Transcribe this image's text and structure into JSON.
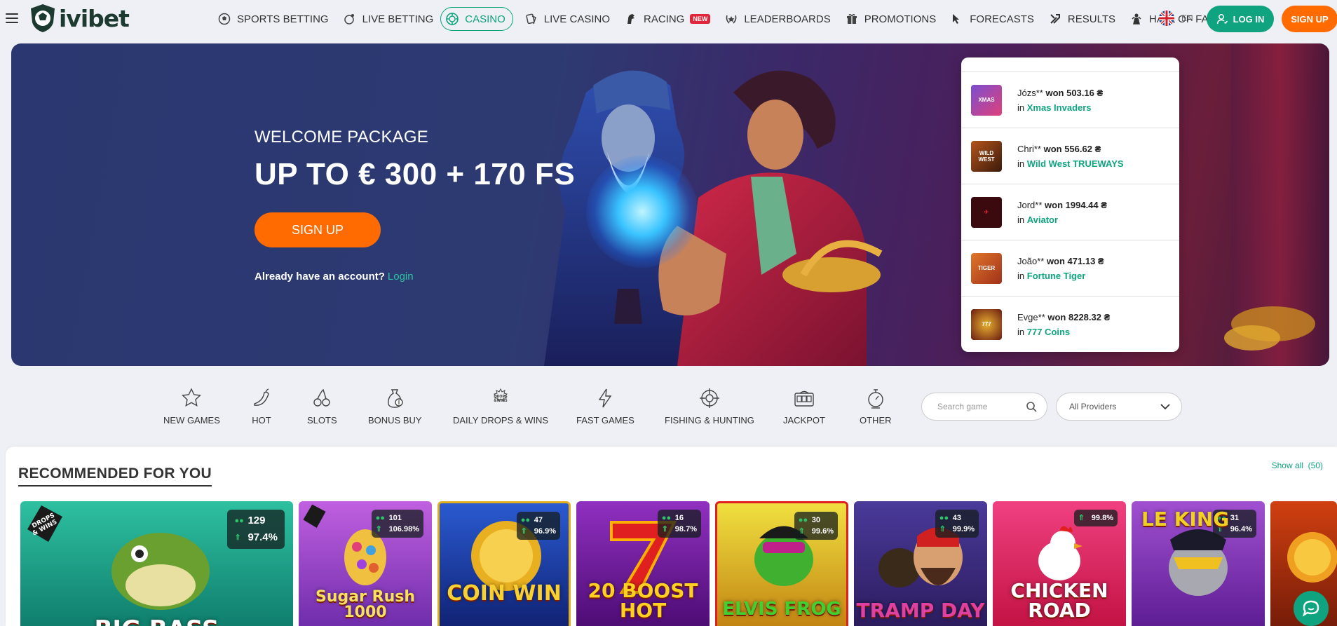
{
  "brand": {
    "name": "ivibet"
  },
  "nav": [
    {
      "label": "SPORTS BETTING",
      "icon": "soccer-ball-icon"
    },
    {
      "label": "LIVE BETTING",
      "icon": "live-ball-icon"
    },
    {
      "label": "CASINO",
      "icon": "casino-chip-icon",
      "active": true
    },
    {
      "label": "LIVE CASINO",
      "icon": "cards-icon"
    },
    {
      "label": "RACING",
      "icon": "horse-icon",
      "badge": "NEW"
    },
    {
      "label": "LEADERBOARDS",
      "icon": "laurel-icon"
    },
    {
      "label": "PROMOTIONS",
      "icon": "gift-icon"
    },
    {
      "label": "FORECASTS",
      "icon": "cursor-icon"
    },
    {
      "label": "RESULTS",
      "icon": "tools-icon"
    },
    {
      "label": "HALL OF FAME",
      "icon": "trophy-icon"
    }
  ],
  "header": {
    "lang": "EN",
    "login": "LOG IN",
    "signup": "SIGN UP"
  },
  "hero": {
    "welcome": "WELCOME PACKAGE",
    "headline": "UP TO € 300 + 170 FS",
    "cta": "SIGN UP",
    "account_text": "Already have an account?",
    "login_link": "Login"
  },
  "winners": [
    {
      "user": "Józs**",
      "won": "won 503.16 ₴",
      "in": "in",
      "game": "Xmas Invaders",
      "color": "#7a4fd0"
    },
    {
      "user": "Chri**",
      "won": "won 556.62 ₴",
      "in": "in",
      "game": "Wild West TRUEWAYS",
      "color": "#b4541c"
    },
    {
      "user": "Jord**",
      "won": "won 1994.44 ₴",
      "in": "in",
      "game": "Aviator",
      "color": "#7a0f14"
    },
    {
      "user": "João**",
      "won": "won 471.13 ₴",
      "in": "in",
      "game": "Fortune Tiger",
      "color": "#e0762a"
    },
    {
      "user": "Evge**",
      "won": "won 8228.32 ₴",
      "in": "in",
      "game": "777 Coins",
      "color": "#6a1a10"
    }
  ],
  "categories": [
    {
      "label": "NEW GAMES",
      "icon": "star-icon"
    },
    {
      "label": "HOT",
      "icon": "chili-icon"
    },
    {
      "label": "SLOTS",
      "icon": "cherries-icon"
    },
    {
      "label": "BONUS BUY",
      "icon": "money-bag-icon"
    },
    {
      "label": "DAILY DROPS & WINS",
      "icon": "drops-wins-icon"
    },
    {
      "label": "FAST GAMES",
      "icon": "lightning-icon"
    },
    {
      "label": "FISHING & HUNTING",
      "icon": "crosshair-icon"
    },
    {
      "label": "JACKPOT",
      "icon": "slot-machine-icon"
    },
    {
      "label": "OTHER",
      "icon": "stopwatch-icon"
    }
  ],
  "search": {
    "placeholder": "Search game",
    "providers": "All Providers"
  },
  "recommended": {
    "title": "RECOMMENDED FOR YOU",
    "show_all": "Show all",
    "count": "(50)",
    "games": [
      {
        "name": "BIG BASS",
        "players": "129",
        "rtp": "97.4%",
        "bg": "#19a88a"
      },
      {
        "name": "Sugar Rush 1000",
        "players": "101",
        "rtp": "106.98%",
        "bg": "#8a3ad0"
      },
      {
        "name": "COIN WIN",
        "players": "47",
        "rtp": "96.9%",
        "bg": "#1d3f9a"
      },
      {
        "name": "20 BOOST HOT",
        "players": "16",
        "rtp": "98.7%",
        "bg": "#7a1aa0"
      },
      {
        "name": "ELVIS FROG",
        "players": "30",
        "rtp": "99.6%",
        "bg": "#d8c01a"
      },
      {
        "name": "TRAMP DAY",
        "players": "43",
        "rtp": "99.9%",
        "bg": "#3a2a7a"
      },
      {
        "name": "CHICKEN ROAD",
        "players": "",
        "rtp": "99.8%",
        "bg": "#e02a6a"
      },
      {
        "name": "LE KING",
        "players": "31",
        "rtp": "96.4%",
        "bg": "#7a2ab0"
      },
      {
        "name": "",
        "players": "",
        "rtp": "",
        "bg": "#c0340a"
      }
    ]
  }
}
